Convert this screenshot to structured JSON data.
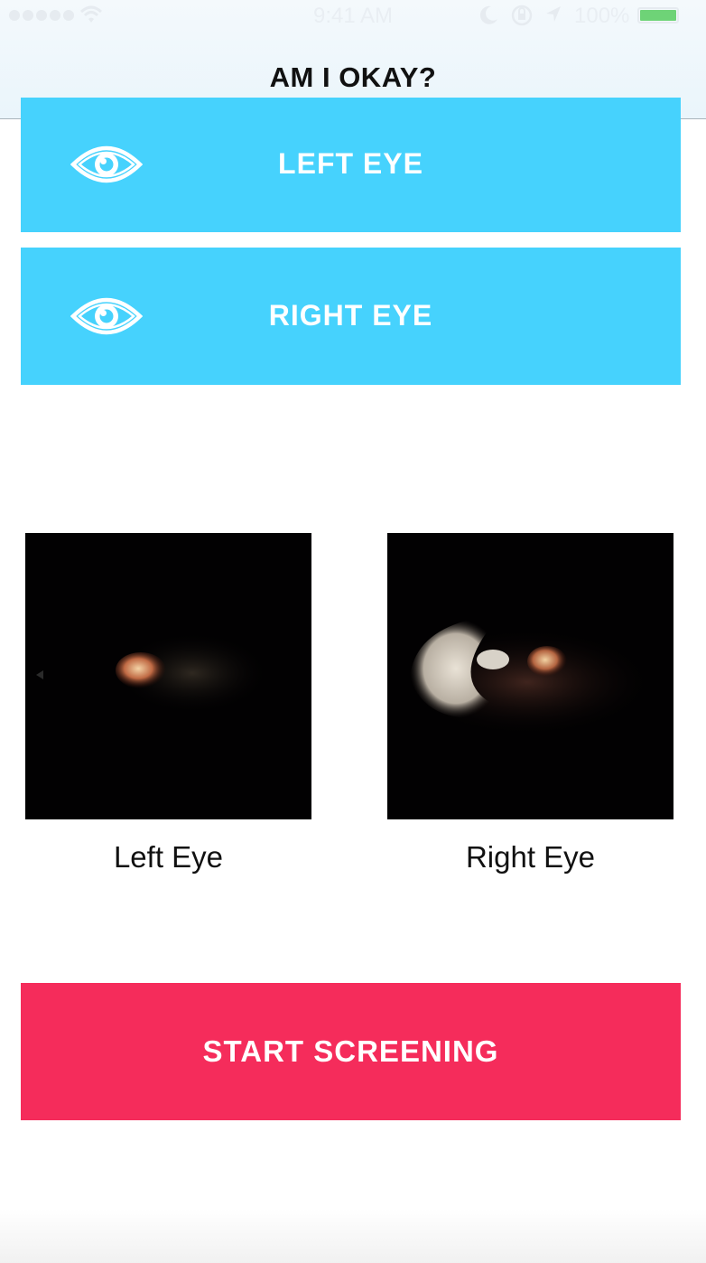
{
  "status_bar": {
    "time": "9:41 AM",
    "battery_percent": "100%",
    "battery_level": 1.0,
    "battery_color": "#6ed377"
  },
  "nav": {
    "title": "AM I OKAY?"
  },
  "eye_buttons": {
    "left_label": "LEFT EYE",
    "right_label": "RIGHT EYE",
    "icon": "eye-icon",
    "color": "#46d2fd"
  },
  "photos": {
    "left_caption": "Left Eye",
    "right_caption": "Right Eye"
  },
  "start": {
    "label": "START SCREENING",
    "color": "#f52c5b"
  }
}
